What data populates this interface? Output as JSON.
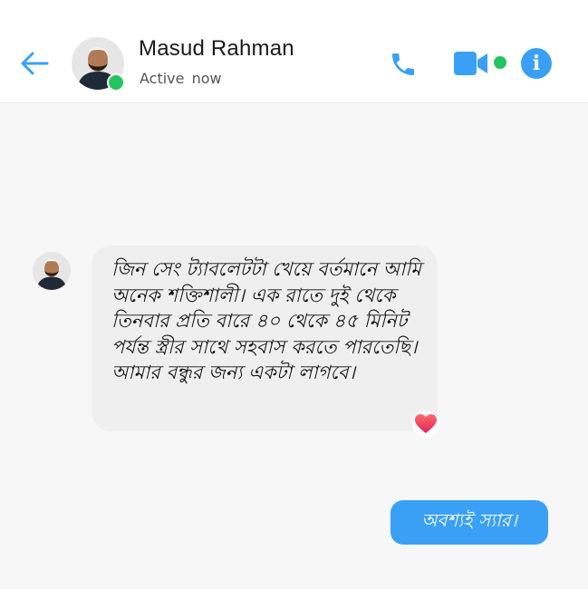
{
  "colors": {
    "accent": "#3aa0f5",
    "online": "#22c55e",
    "incoming_bubble": "#efefef",
    "reaction": "#ef4444"
  },
  "header": {
    "contact_name": "Masud Rahman",
    "status": "Active  now",
    "icons": {
      "back": "back-arrow-icon",
      "phone": "phone-icon",
      "video": "video-camera-icon",
      "info": "info-icon"
    },
    "info_glyph": "i"
  },
  "messages": [
    {
      "direction": "incoming",
      "text": "জিন সেং ট্যাবলেটটা খেয়ে বর্তমানে আমি অনেক শক্তিশালী। এক রাতে দুই থেকে তিনবার প্রতি বারে ৪০ থেকে ৪৫ মিনিট পর্যন্ত স্ত্রীর সাথে সহবাস করতে পারতেছি। আমার বন্ধুর জন্য একটা লাগবে।",
      "reaction": "heart-reaction-icon"
    },
    {
      "direction": "outgoing",
      "text": "অবশ্যই স্যার।"
    }
  ]
}
